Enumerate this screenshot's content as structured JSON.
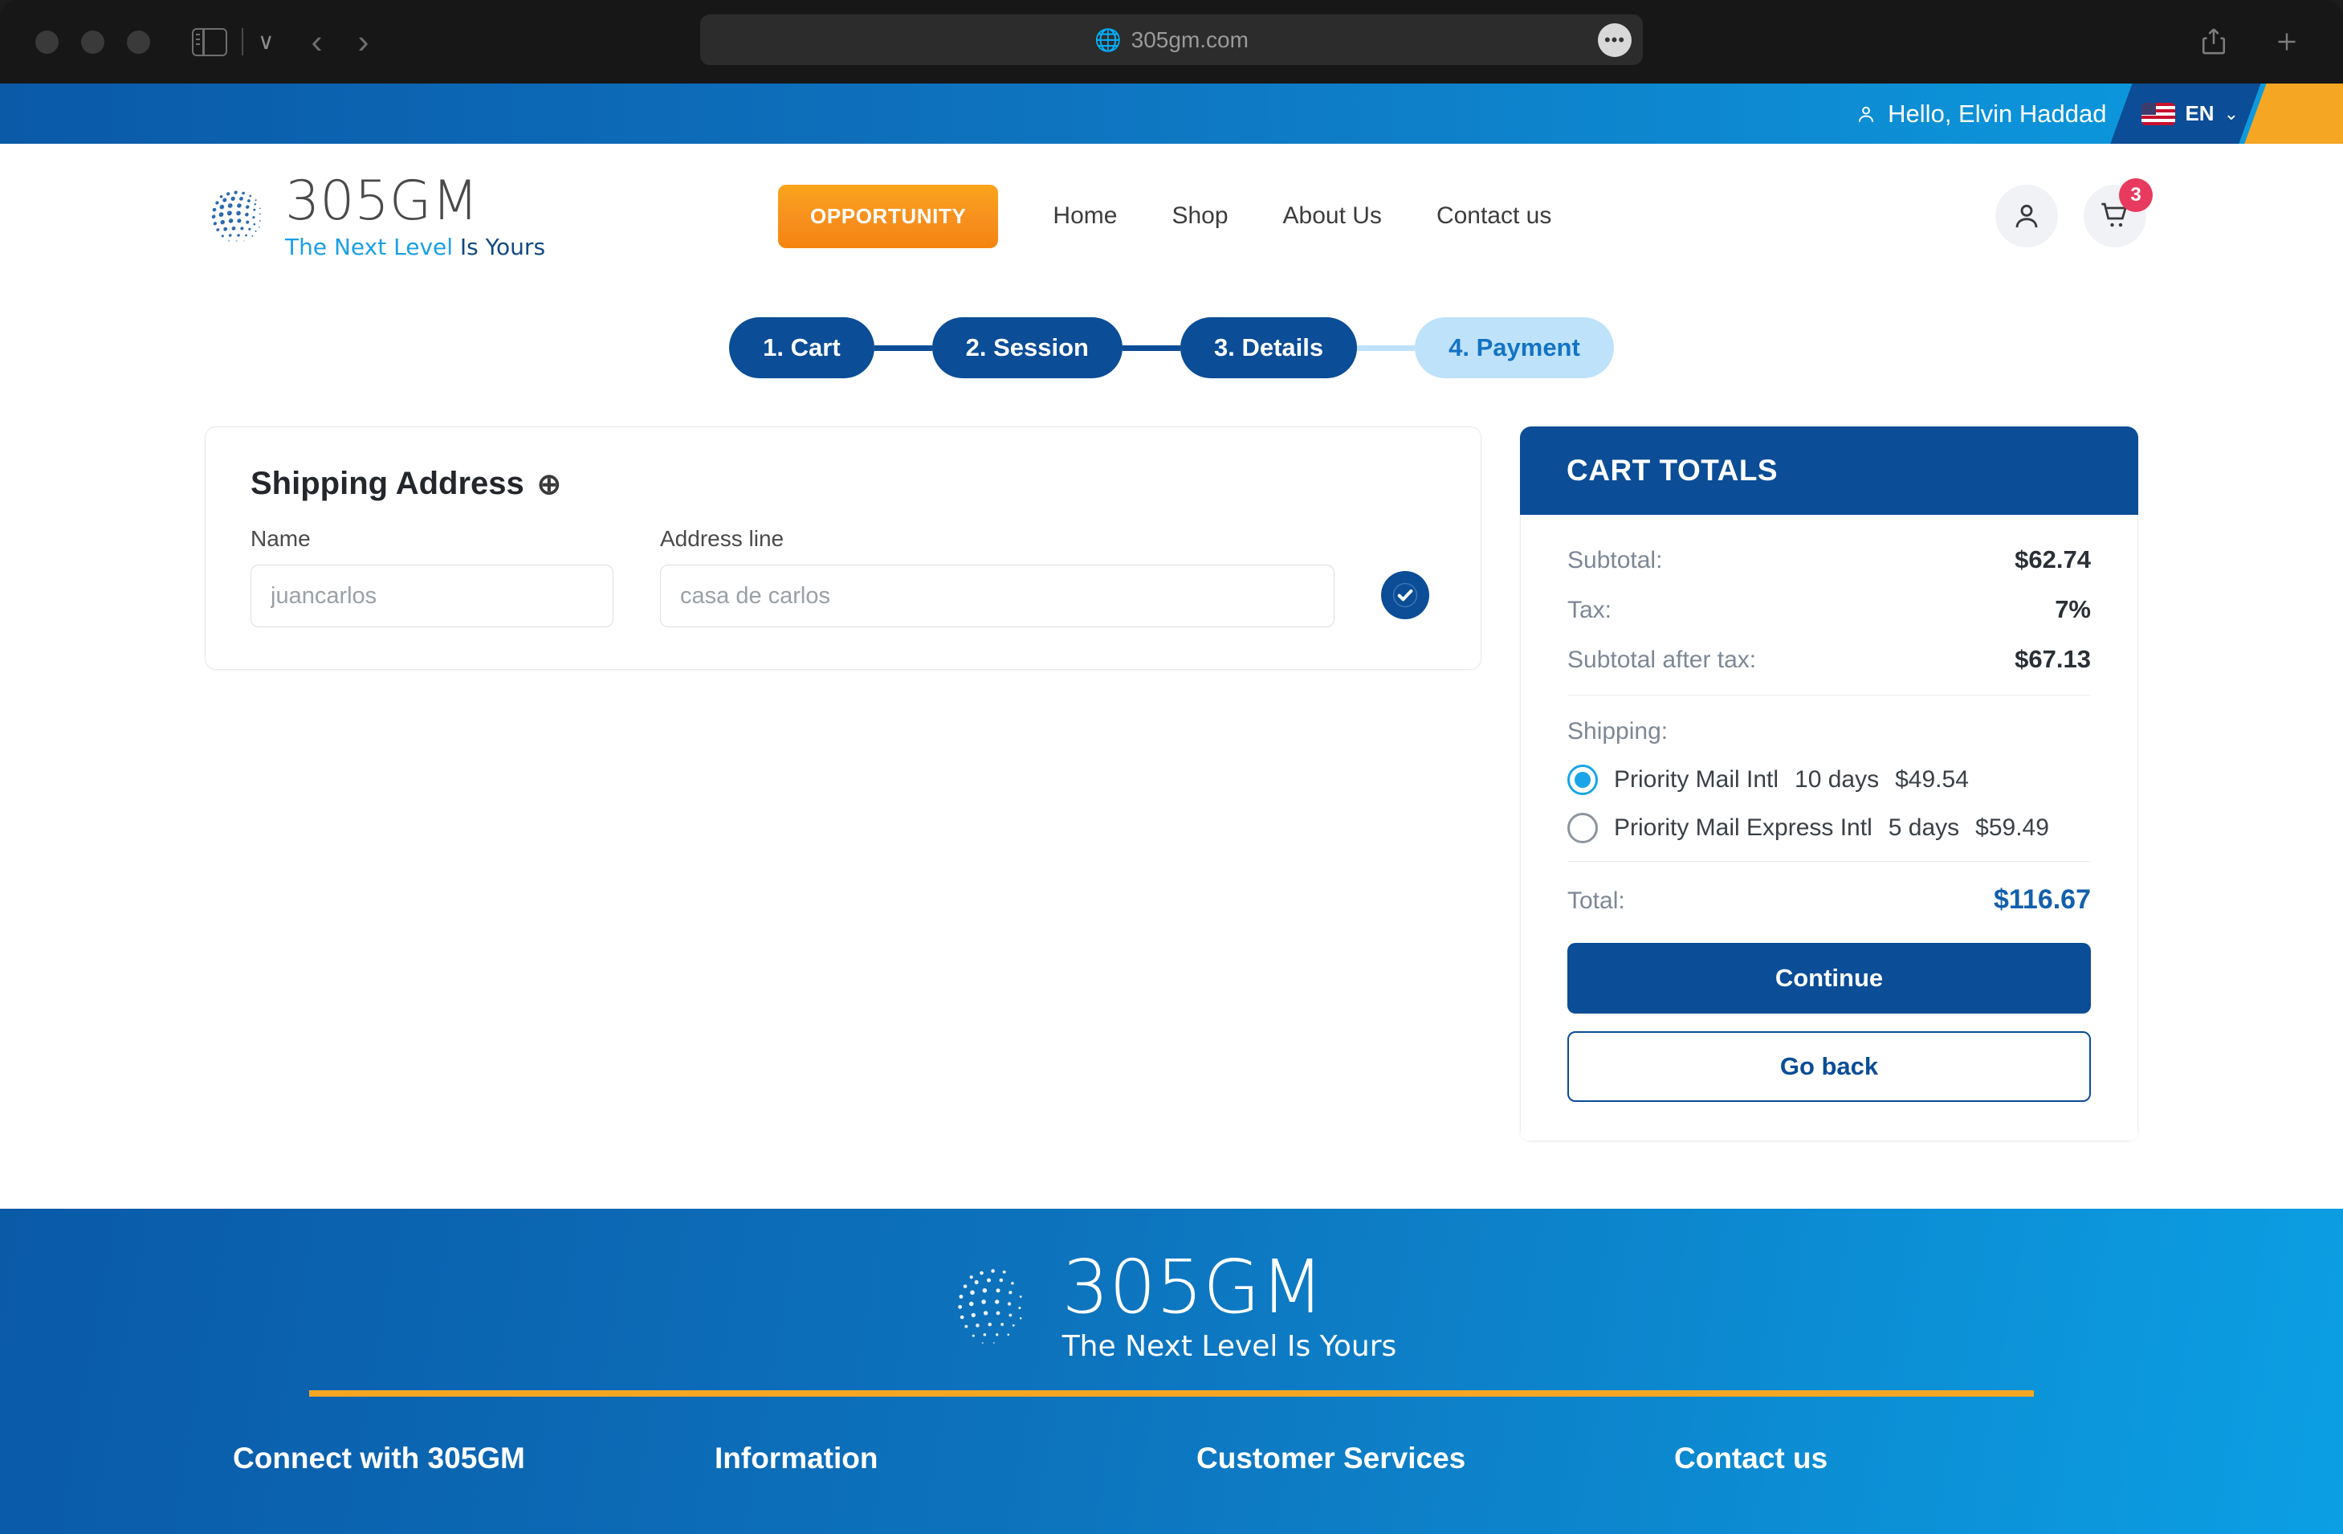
{
  "browser": {
    "url": "305gm.com",
    "globe_icon": "globe-icon",
    "more_label": "•••",
    "back_label": "‹",
    "forward_label": "›",
    "chevron_label": "∨"
  },
  "topbar": {
    "greeting": "Hello, Elvin Haddad",
    "language": "EN",
    "caret": "⌄",
    "colors": {
      "start": "#0a5aa8",
      "end": "#0c9ce0",
      "stripe_dark": "#0b4d96",
      "stripe_orange": "#f5a623"
    }
  },
  "header": {
    "logo_main": "305GM",
    "logo_sub_a": "The Next Level ",
    "logo_sub_b": "Is Yours",
    "opportunity_button": "OPPORTUNITY",
    "nav": [
      {
        "label": "Home"
      },
      {
        "label": "Shop"
      },
      {
        "label": "About Us"
      },
      {
        "label": "Contact us"
      }
    ],
    "cart_count": "3",
    "accent_orange": "#f7901e"
  },
  "steps": [
    {
      "label": "1. Cart",
      "active": true
    },
    {
      "label": "2. Session",
      "active": true
    },
    {
      "label": "3. Details",
      "active": true
    },
    {
      "label": "4. Payment",
      "active": false
    }
  ],
  "shipping_form": {
    "title": "Shipping Address",
    "add_icon": "plus-circle-icon",
    "name_label": "Name",
    "name_value": "juancarlos",
    "address_label": "Address line",
    "address_value": "casa de carlos",
    "confirm_icon": "check-icon"
  },
  "cart_totals": {
    "heading": "CART TOTALS",
    "rows": [
      {
        "label": "Subtotal:",
        "value": "$62.74"
      },
      {
        "label": "Tax:",
        "value": "7%"
      },
      {
        "label": "Subtotal after tax:",
        "value": "$67.13"
      }
    ],
    "shipping_label": "Shipping:",
    "shipping_options": [
      {
        "name": "Priority Mail Intl",
        "days": "10 days",
        "price": "$49.54",
        "selected": true
      },
      {
        "name": "Priority Mail Express Intl",
        "days": "5 days",
        "price": "$59.49",
        "selected": false
      }
    ],
    "total_label": "Total:",
    "total_value": "$116.67",
    "continue_label": "Continue",
    "go_back_label": "Go back",
    "header_color": "#0b4d96",
    "total_color": "#1360ab"
  },
  "footer": {
    "logo_main": "305GM",
    "logo_sub": "The Next Level Is Yours",
    "divider_color": "#f5a623",
    "columns": [
      {
        "title": "Connect with 305GM"
      },
      {
        "title": "Information"
      },
      {
        "title": "Customer Services"
      },
      {
        "title": "Contact us"
      }
    ]
  }
}
